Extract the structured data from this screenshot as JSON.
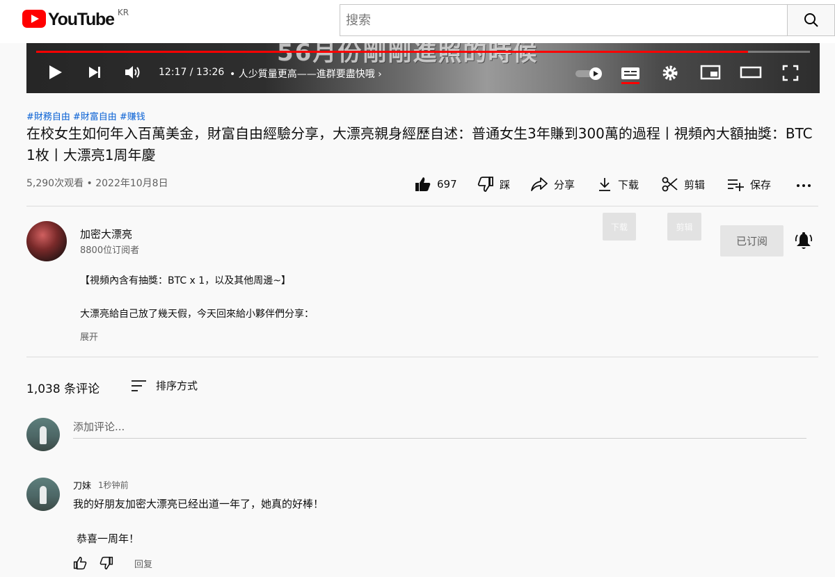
{
  "header": {
    "logo_text": "YouTube",
    "country_code": "KR",
    "search_placeholder": "搜索"
  },
  "player": {
    "overlay_text": "56月份剛剛進照的時候",
    "time": "12:17 / 13:26",
    "chapter": "• 人少質量更高——進群要盡快哦 ›",
    "progress_fraction": 0.92
  },
  "video": {
    "hashtags": [
      "#財務自由",
      "#財富自由",
      "#赚钱"
    ],
    "title": "在校女生如何年入百萬美金，財富自由經驗分享，大漂亮親身經歷自述：普通女生3年賺到300萬的過程丨視頻內大額抽獎：BTC 1枚丨大漂亮1周年慶",
    "views": "5,290次观看 • 2022年10月8日",
    "likes": "697",
    "dislike_label": "踩",
    "share_label": "分享",
    "download_label": "下载",
    "clip_label": "剪辑",
    "save_label": "保存"
  },
  "channel": {
    "name": "加密大漂亮",
    "subscribers": "8800位订阅者",
    "ghost_download": "下载",
    "ghost_clip": "剪辑",
    "subscribe_label": "已订阅"
  },
  "description": {
    "line1": "【視頻內含有抽獎：BTC x 1，以及其他周邊~】",
    "line2": "大漂亮給自己放了幾天假，今天回來給小夥伴們分享：",
    "expand": "展开"
  },
  "comments": {
    "count": "1,038 条评论",
    "sort_label": "排序方式",
    "add_placeholder": "添加评论...",
    "items": [
      {
        "author": "刀妹",
        "time": "1秒钟前",
        "text1": "我的好朋友加密大漂亮已经出道一年了，她真的好棒！",
        "text2": "恭喜一周年！",
        "reply_label": "回复"
      }
    ]
  },
  "colors": {
    "brand_red": "#ff0000",
    "link_blue": "#065fd4",
    "secondary_text": "#606060"
  }
}
